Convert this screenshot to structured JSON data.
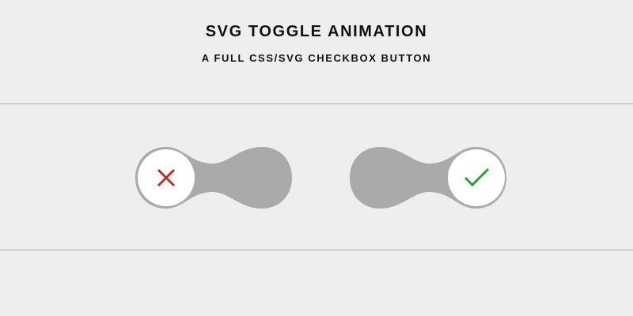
{
  "header": {
    "title": "SVG TOGGLE ANIMATION",
    "subtitle": "A FULL CSS/SVG CHECKBOX BUTTON"
  },
  "toggles": [
    {
      "state": "unchecked",
      "icon": "x-icon",
      "icon_color": "#c62828"
    },
    {
      "state": "checked",
      "icon": "check-icon",
      "icon_color": "#2ca02c"
    }
  ],
  "colors": {
    "background": "#eeeeee",
    "track": "#aaaaaa",
    "knob": "#ffffff",
    "divider": "#a6a6a6"
  }
}
